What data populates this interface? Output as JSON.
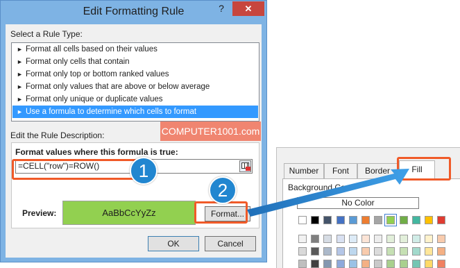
{
  "dialog": {
    "title": "Edit Formatting Rule",
    "help_glyph": "?",
    "close_glyph": "✕",
    "rule_type_label": "Select a Rule Type:",
    "rule_types": [
      "Format all cells based on their values",
      "Format only cells that contain",
      "Format only top or bottom ranked values",
      "Format only values that are above or below average",
      "Format only unique or duplicate values",
      "Use a formula to determine which cells to format"
    ],
    "selected_rule_index": 5,
    "description_label": "Edit the Rule Description:",
    "formula_label": "Format values where this formula is true:",
    "formula_value": "=CELL(\"row\")=ROW()",
    "preview_label": "Preview:",
    "preview_text": "AaBbCcYyZz",
    "format_button": "Format...",
    "ok_button": "OK",
    "cancel_button": "Cancel"
  },
  "watermark": "COMPUTER1001.com",
  "format_cells": {
    "tabs": [
      "Number",
      "Font",
      "Border",
      "Fill"
    ],
    "active_tab": "Fill",
    "background_label": "Background Co",
    "no_color_button": "No Color"
  },
  "callouts": {
    "step1": "1",
    "step2": "2"
  },
  "colors": {
    "preview_fill": "#92d050",
    "selection": "#3399ff",
    "highlight": "#f05a28",
    "badge": "#2186d0",
    "palette_row1": [
      "#ffffff",
      "#000000",
      "#44546a",
      "#4472c4",
      "#5b9bd5",
      "#ed7d31",
      "#a5a5a5",
      "#92d050",
      "#70ad47",
      "#43b7a0",
      "#ffc000",
      "#e03c31"
    ],
    "palette_row2": [
      "#f2f2f2",
      "#7f7f7f",
      "#d6dce4",
      "#d9e1f2",
      "#ddebf7",
      "#fce4d6",
      "#ededed",
      "#e2efda",
      "#e2efda",
      "#d0ece7",
      "#fff2cc",
      "#f8cbad"
    ],
    "palette_row3": [
      "#d9d9d9",
      "#595959",
      "#acb9ca",
      "#b4c6e7",
      "#bdd7ee",
      "#f8cbad",
      "#dbdbdb",
      "#c6e0b4",
      "#c6e0b4",
      "#a2d9cc",
      "#ffe699",
      "#f4b084"
    ],
    "palette_row4": [
      "#bfbfbf",
      "#404040",
      "#8497b0",
      "#8ea9db",
      "#9bc2e6",
      "#f4b084",
      "#c9c9c9",
      "#a9d08e",
      "#a9d08e",
      "#74c6b3",
      "#ffd966",
      "#f08060"
    ]
  }
}
